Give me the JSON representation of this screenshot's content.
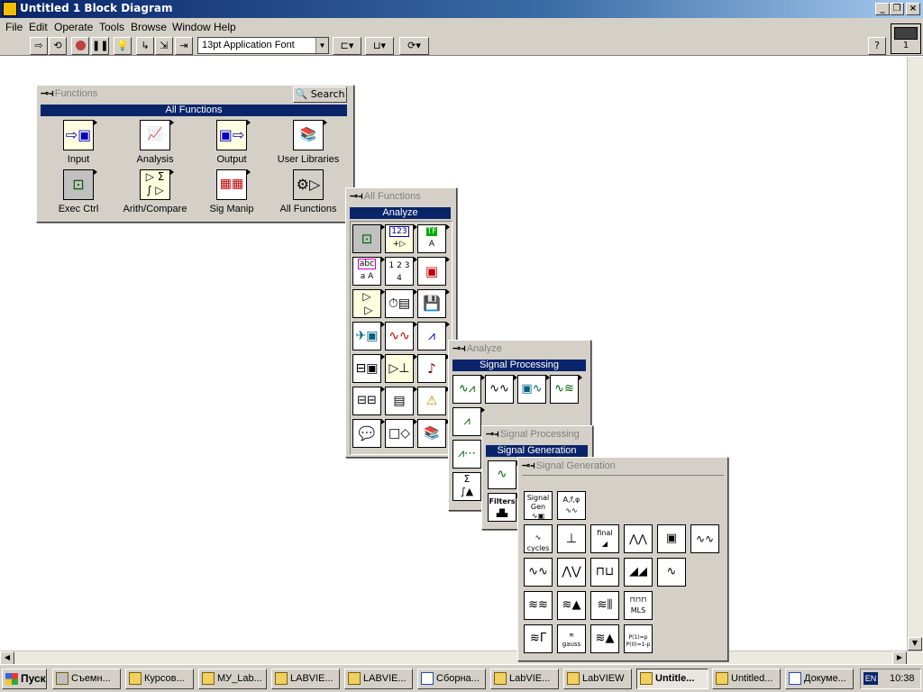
{
  "window": {
    "title": "Untitled 1 Block Diagram",
    "min_glyph": "_",
    "max_glyph": "❐",
    "close_glyph": "×"
  },
  "menu": [
    "File",
    "Edit",
    "Operate",
    "Tools",
    "Browse",
    "Window",
    "Help"
  ],
  "toolbar": {
    "font": "13pt Application Font",
    "vi_number": "1"
  },
  "functions_palette": {
    "title": "Functions",
    "search": "Search",
    "header": "All Functions",
    "items": [
      "Input",
      "Analysis",
      "Output",
      "User Libraries",
      "Exec Ctrl",
      "Arith/Compare",
      "Sig Manip",
      "All Functions"
    ]
  },
  "all_functions_palette": {
    "title": "All Functions",
    "header": "Analyze",
    "glyph_123": "123",
    "glyph_tf": "TF",
    "glyph_abc": "abc",
    "glyph_a": "A",
    "glyph_aa": "a A",
    "glyph_1234": "1 2 3 4"
  },
  "analyze_palette": {
    "title": "Analyze",
    "header": "Signal Processing"
  },
  "signal_processing_palette": {
    "title": "Signal Processing",
    "header": "Signal Generation",
    "filters_label": "Filters"
  },
  "signal_generation_palette": {
    "title": "Signal Generation",
    "sig_gen_label": "Signal Gen",
    "afo_label": "A,f,φ",
    "cycles_label": "cycles",
    "final_label": "final",
    "gauss_label": "gauss",
    "mls_label": "MLS",
    "prob_label": "P(1)=p P(0)=1-p"
  },
  "taskbar": {
    "start": "Пуск",
    "tasks": [
      "Съемн...",
      "Курсов...",
      "МУ_Lab...",
      "LABVIE...",
      "LABVIE...",
      "Сборна...",
      "LabVIE...",
      "LabVIEW",
      "Untitle...",
      "Untitled...",
      "Докуме..."
    ],
    "active_index": 8,
    "lang": "EN",
    "clock": "10:38"
  }
}
